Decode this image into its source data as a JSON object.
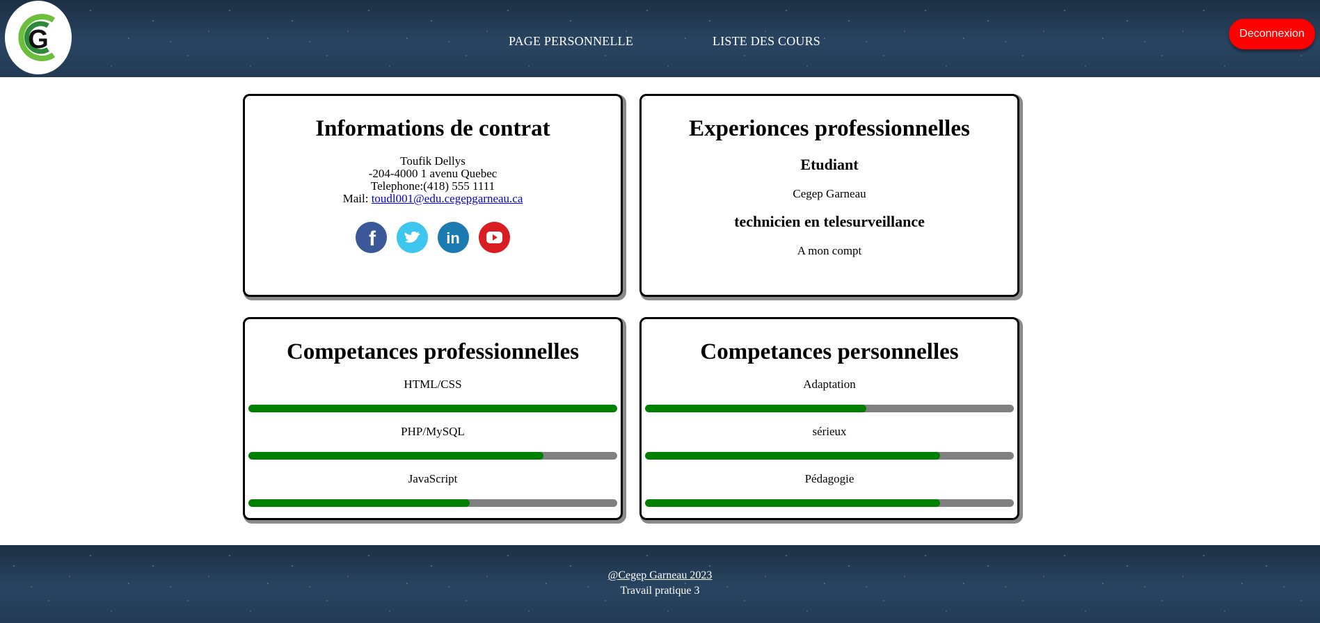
{
  "header": {
    "nav": [
      "PAGE PERSONNELLE",
      "LISTE DES COURS"
    ],
    "logout_label": "Deconnexion",
    "logo_letter": "G"
  },
  "contact": {
    "title": "Informations de contrat",
    "name": "Toufik Dellys",
    "address": "-204-4000 1 avenu Quebec",
    "phone": "Telephone:(418) 555 1111",
    "mail_label": "Mail: ",
    "mail": "toudl001@edu.cegepgarneau.ca",
    "socials": [
      "facebook-icon",
      "twitter-icon",
      "linkedin-icon",
      "youtube-icon"
    ]
  },
  "experience": {
    "title": "Experionces professionnelles",
    "items": [
      {
        "role": "Etudiant",
        "place": "Cegep Garneau"
      },
      {
        "role": "technicien en telesurveillance",
        "place": "A mon compt"
      }
    ]
  },
  "skills_prof": {
    "title": "Competances professionnelles",
    "items": [
      {
        "label": "HTML/CSS",
        "level": 1.0
      },
      {
        "label": "PHP/MySQL",
        "level": 0.8
      },
      {
        "label": "JavaScript",
        "level": 0.6
      }
    ]
  },
  "skills_perso": {
    "title": "Competances personnelles",
    "items": [
      {
        "label": "Adaptation",
        "level": 0.6
      },
      {
        "label": "sérieux",
        "level": 0.8
      },
      {
        "label": "Pédagogie",
        "level": 0.8
      }
    ]
  },
  "footer": {
    "copyright": "@Cegep Garneau 2023",
    "subtitle": "Travail pratique 3"
  },
  "colors": {
    "logout": "#ff0000",
    "bar_fill": "#008000",
    "bar_track": "#808080"
  }
}
